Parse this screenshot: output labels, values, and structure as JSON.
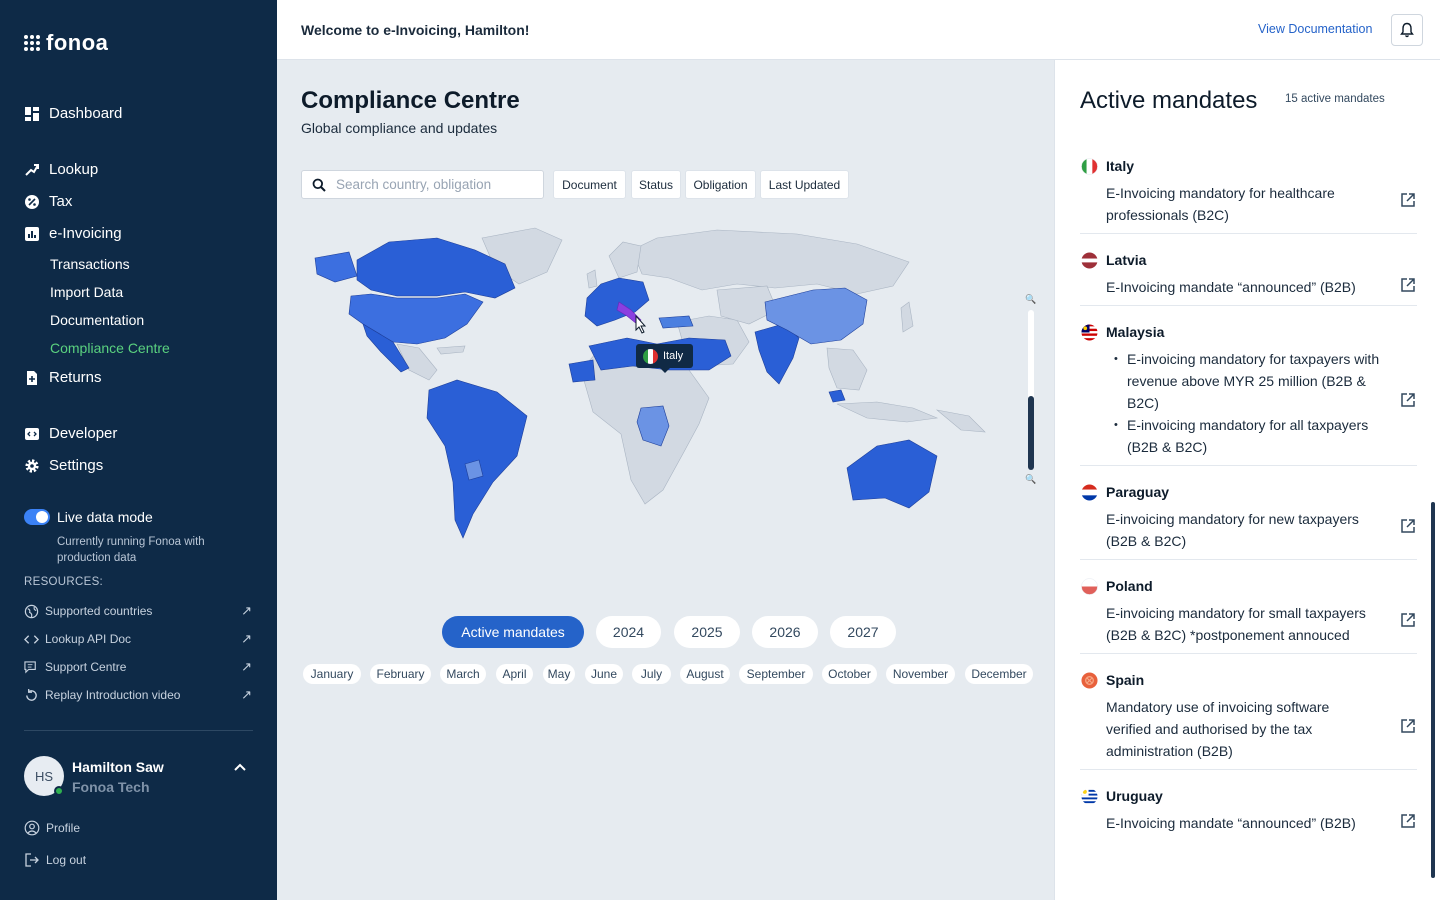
{
  "brand": {
    "name": "fonoa"
  },
  "sidebar": {
    "nav": [
      {
        "label": "Dashboard",
        "icon": "dashboard-icon"
      },
      {
        "label": "Lookup",
        "icon": "lookup-icon"
      },
      {
        "label": "Tax",
        "icon": "tax-icon"
      },
      {
        "label": "e-Invoicing",
        "icon": "einvoicing-icon"
      },
      {
        "label": "Returns",
        "icon": "returns-icon"
      },
      {
        "label": "Developer",
        "icon": "developer-icon"
      },
      {
        "label": "Settings",
        "icon": "gear-icon"
      }
    ],
    "einvoicing_sub": [
      {
        "label": "Transactions"
      },
      {
        "label": "Import Data"
      },
      {
        "label": "Documentation"
      },
      {
        "label": "Compliance Centre",
        "active": true
      }
    ],
    "live_mode": {
      "label": "Live data mode",
      "enabled": true,
      "description": "Currently running Fonoa with production data"
    },
    "resources": {
      "heading": "RESOURCES:",
      "items": [
        {
          "label": "Supported countries",
          "icon": "globe-icon"
        },
        {
          "label": "Lookup API Doc",
          "icon": "code-icon"
        },
        {
          "label": "Support Centre",
          "icon": "chat-icon"
        },
        {
          "label": "Replay Introduction video",
          "icon": "replay-icon"
        }
      ]
    },
    "user": {
      "initials": "HS",
      "name": "Hamilton Saw",
      "org": "Fonoa Tech",
      "online": true
    },
    "account_links": [
      {
        "label": "Profile",
        "icon": "user-icon"
      },
      {
        "label": "Log out",
        "icon": "logout-icon"
      }
    ]
  },
  "topbar": {
    "welcome": "Welcome to e-Invoicing, Hamilton!",
    "doc_link": "View Documentation"
  },
  "main": {
    "title": "Compliance Centre",
    "subtitle": "Global compliance and updates",
    "search": {
      "placeholder": "Search country, obligation",
      "value": ""
    },
    "filters": [
      "Document",
      "Status",
      "Obligation",
      "Last Updated"
    ],
    "map_tooltip": {
      "country": "Italy"
    },
    "year_tabs": [
      {
        "label": "Active mandates",
        "active": true
      },
      {
        "label": "2024"
      },
      {
        "label": "2025"
      },
      {
        "label": "2026"
      },
      {
        "label": "2027"
      }
    ],
    "months": [
      "January",
      "February",
      "March",
      "April",
      "May",
      "June",
      "July",
      "August",
      "September",
      "October",
      "November",
      "December"
    ]
  },
  "panel": {
    "title": "Active mandates",
    "count": "15 active mandates",
    "mandates": [
      {
        "country": "Italy",
        "flag_colors": [
          "#2f9e44",
          "#ffffff",
          "#e03131"
        ],
        "lines": [
          "E-Invoicing mandatory for healthcare professionals (B2C)"
        ]
      },
      {
        "country": "Latvia",
        "flag_colors": [
          "#9e3039",
          "#ffffff",
          "#9e3039"
        ],
        "lines": [
          "E-Invoicing mandate “announced” (B2B)"
        ]
      },
      {
        "country": "Malaysia",
        "flag_colors": [
          "#cc0001",
          "#ffffff",
          "#010066"
        ],
        "bullets": [
          "E-invoicing mandatory for taxpayers with revenue above MYR 25 million (B2B & B2C)",
          "E-invoicing mandatory for all taxpayers (B2B & B2C)"
        ]
      },
      {
        "country": "Paraguay",
        "flag_colors": [
          "#d52b1e",
          "#ffffff",
          "#0038a8"
        ],
        "lines": [
          "E-invoicing mandatory for new taxpayers (B2B & B2C)"
        ]
      },
      {
        "country": "Poland",
        "flag_colors": [
          "#ffffff",
          "#dc143c"
        ],
        "lines": [
          "E-invoicing mandatory for small taxpayers (B2B & B2C) *postponement annouced"
        ]
      },
      {
        "country": "Spain",
        "flag_colors": [
          "#e8613c",
          "#f28c5c",
          "#e8613c"
        ],
        "lines": [
          "Mandatory use of invoicing software verified and authorised by the tax administration (B2B)"
        ]
      },
      {
        "country": "Uruguay",
        "flag_colors": [
          "#0038a8",
          "#ffffff",
          "#0038a8"
        ],
        "lines": [
          "E-Invoicing mandate “announced” (B2B)"
        ]
      }
    ]
  },
  "colors": {
    "sidebar_bg": "#0e2a47",
    "accent": "#2563c9",
    "active_nav": "#5ad17f",
    "map_mandate": "#2a5fd6",
    "map_light": "#6b93e4",
    "map_highlight": "#8b3fe0",
    "map_none": "#d2d9e2"
  }
}
